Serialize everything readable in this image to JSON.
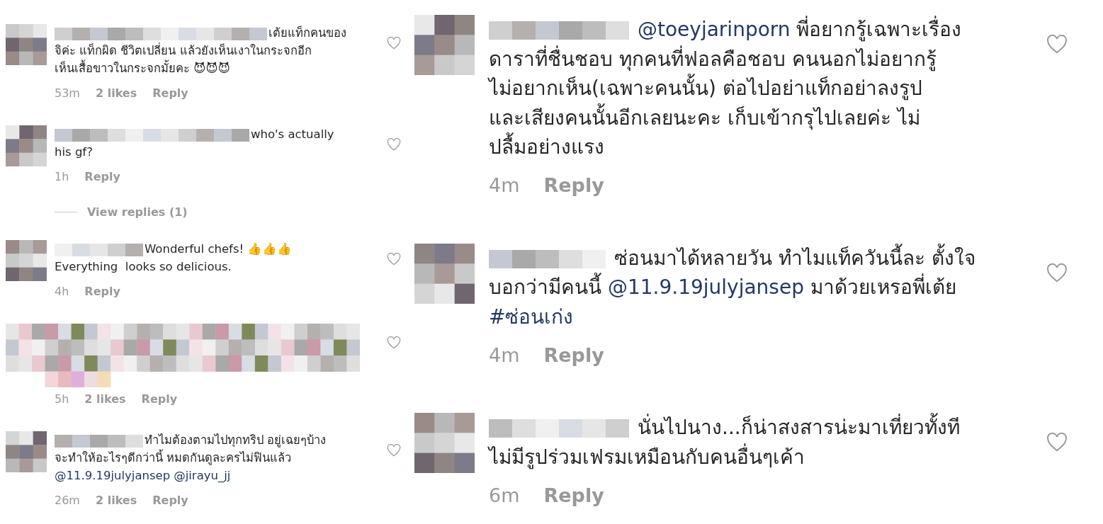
{
  "panels": [
    {
      "items": [
        {
          "kind": "comment",
          "lines": [
            [
              {
                "kind": "text",
                "t": "เต้ยแท็กคนของ"
              }
            ],
            [
              {
                "kind": "text",
                "t": "จิค่ะ แท็กผิด ชีวิตเปลี่ยน แล้วยังเห็นเงาในกระจกอีก"
              }
            ],
            [
              {
                "kind": "text",
                "t": "เห็นเสื้อขาวในกระจกมั้ยคะ 😈😈😈"
              }
            ]
          ],
          "time": "53m",
          "likes": "2 likes",
          "reply": "Reply"
        },
        {
          "kind": "comment",
          "lines": [
            [
              {
                "kind": "text",
                "t": "who's actually"
              }
            ],
            [
              {
                "kind": "text",
                "t": "his gf?"
              }
            ]
          ],
          "time": "1h",
          "reply": "Reply"
        },
        {
          "kind": "view_replies",
          "label": "View replies (1)"
        },
        {
          "kind": "comment",
          "lines": [
            [
              {
                "kind": "text",
                "t": "Wonderful chefs! 👍👍👍"
              }
            ],
            [
              {
                "kind": "text",
                "t": "Everything  looks so delicious."
              }
            ]
          ],
          "time": "4h",
          "reply": "Reply"
        },
        {
          "kind": "comment",
          "time": "5h",
          "likes": "2 likes",
          "reply": "Reply"
        },
        {
          "kind": "comment",
          "lines": [
            [
              {
                "kind": "text",
                "t": "ทำไมต้องตามไปทุกทริป อยู่เฉยๆบ้าง"
              }
            ],
            [
              {
                "kind": "text",
                "t": "จะทำให้อะไรๆดีกว่านี้ หมดกันดูละครไม่ฟินแล้ว"
              }
            ],
            [
              {
                "kind": "mention",
                "t": "@11.9.19julyjansep"
              },
              {
                "kind": "mention",
                "t": "@jirayu_jj"
              }
            ]
          ],
          "time": "26m",
          "likes": "2 likes",
          "reply": "Reply"
        }
      ]
    },
    {
      "items": [
        {
          "kind": "comment",
          "lines": [
            [
              {
                "kind": "mention",
                "t": "@toeyjarinporn"
              },
              {
                "kind": "text",
                "t": " พี่อยากรู้เฉพาะเรื่อง"
              }
            ],
            [
              {
                "kind": "text",
                "t": "ดาราที่ชื่นชอบ ทุกคนที่ฟอลคือชอบ คนนอกไม่อยากรู้"
              }
            ],
            [
              {
                "kind": "text",
                "t": "ไม่อยากเห็น(เฉพาะคนนั้น) ต่อไปอย่าแท็กอย่าลงรูป"
              }
            ],
            [
              {
                "kind": "text",
                "t": "และเสียงคนนั้นอีกเลยนะคะ เก็บเข้ากรุไปเลยค่ะ ไม่"
              }
            ],
            [
              {
                "kind": "text",
                "t": "ปลื้มอย่างแรง"
              }
            ]
          ],
          "time": "4m",
          "reply": "Reply"
        },
        {
          "kind": "comment",
          "lines": [
            [
              {
                "kind": "text",
                "t": "ซ่อนมาได้หลายวัน ทำไมแท็ควันนี้ละ ตั้งใจ"
              }
            ],
            [
              {
                "kind": "text",
                "t": "บอกว่ามีคนนี้ "
              },
              {
                "kind": "mention",
                "t": "@11.9.19julyjansep"
              },
              {
                "kind": "text",
                "t": " มาด้วยเหรอพี่เต้ย"
              }
            ],
            [
              {
                "kind": "mention",
                "t": "#ซ่อนเก่ง"
              }
            ]
          ],
          "time": "4m",
          "reply": "Reply"
        },
        {
          "kind": "comment",
          "lines": [
            [
              {
                "kind": "text",
                "t": "นั่นไปนาง...ก็น่าสงสารน่ะมาเที่ยวทั้งที"
              }
            ],
            [
              {
                "kind": "text",
                "t": "ไม่มีรูปร่วมเฟรมเหมือนกับคนอื่นๆเค้า"
              }
            ]
          ],
          "time": "6m",
          "reply": "Reply"
        }
      ]
    }
  ]
}
